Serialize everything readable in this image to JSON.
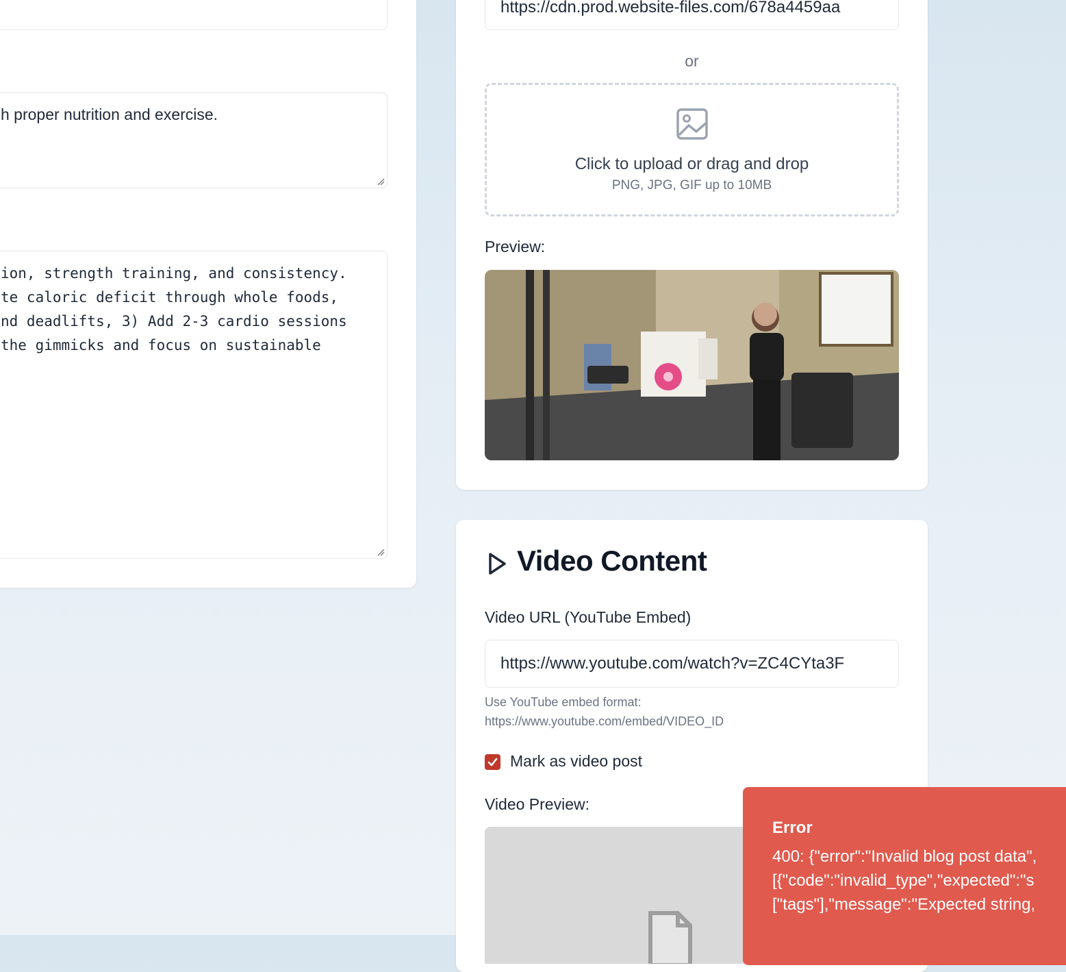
{
  "left_panel": {
    "excerpt_value": "h proper nutrition and exercise.",
    "content_lines": [
      "ion, strength training, and consistency.",
      "te caloric deficit through whole foods,",
      "nd deadlifts, 3) Add 2-3 cardio sessions",
      "the gimmicks and focus on sustainable"
    ]
  },
  "image_section": {
    "url_value": "https://cdn.prod.website-files.com/678a4459aa",
    "or_text": "or",
    "upload_title": "Click to upload or drag and drop",
    "upload_hint": "PNG, JPG, GIF up to 10MB",
    "preview_label": "Preview:"
  },
  "video_section": {
    "title": "Video Content",
    "url_label": "Video URL (YouTube Embed)",
    "url_value": "https://www.youtube.com/watch?v=ZC4CYta3F",
    "hint_line1": "Use YouTube embed format:",
    "hint_line2": "https://www.youtube.com/embed/VIDEO_ID",
    "checkbox_label": "Mark as video post",
    "checkbox_checked": true,
    "preview_label": "Video Preview:"
  },
  "toast": {
    "title": "Error",
    "line1": "400: {\"error\":\"Invalid blog post data\",",
    "line2": "[{\"code\":\"invalid_type\",\"expected\":\"s",
    "line3": "[\"tags\"],\"message\":\"Expected string,"
  },
  "colors": {
    "accent": "#c0392b",
    "toast_bg": "#e05a4e"
  }
}
